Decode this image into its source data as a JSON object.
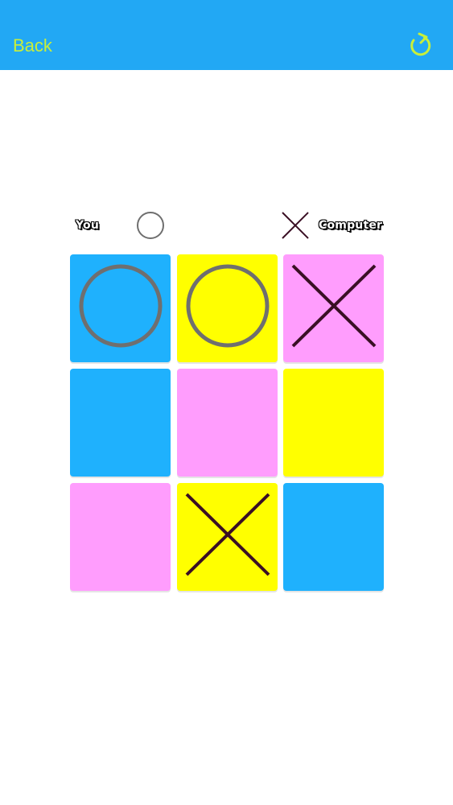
{
  "nav": {
    "back_label": "Back",
    "refresh_icon": "refresh-icon",
    "bar_color": "#22a8f4",
    "accent_color": "#c8ef3a"
  },
  "players": {
    "you_label": "You",
    "you_symbol": "O",
    "computer_label": "Computer",
    "computer_symbol": "X"
  },
  "board": {
    "rows": 3,
    "cols": 3,
    "cells": [
      {
        "color": "#1fb1fd",
        "mark": "O"
      },
      {
        "color": "#ffff00",
        "mark": "O"
      },
      {
        "color": "#ff9dfd",
        "mark": "X"
      },
      {
        "color": "#1fb1fd",
        "mark": ""
      },
      {
        "color": "#ff9dfd",
        "mark": ""
      },
      {
        "color": "#ffff00",
        "mark": ""
      },
      {
        "color": "#ff9dfd",
        "mark": ""
      },
      {
        "color": "#ffff00",
        "mark": "X"
      },
      {
        "color": "#1fb1fd",
        "mark": ""
      }
    ],
    "o_color": "#6f6f6f",
    "x_color": "#3a0f24"
  }
}
